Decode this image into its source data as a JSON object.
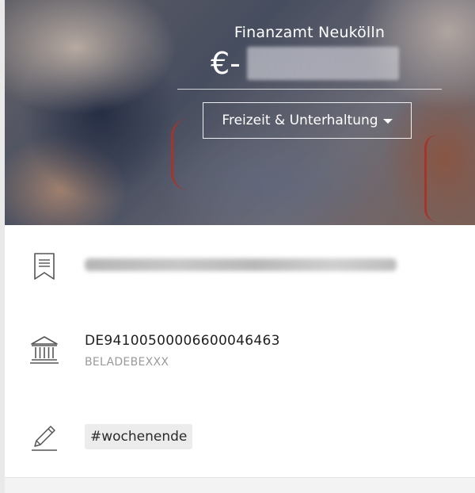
{
  "transaction": {
    "merchant": "Finanzamt Neukölln",
    "amount_prefix": "€-",
    "category_label": "Freizeit & Unterhaltung"
  },
  "details": {
    "iban": "DE94100500006600046463",
    "bic": "BELADEBEXXX"
  },
  "tags": [
    "#wochenende"
  ],
  "icons": {
    "reference": "bookmark-icon",
    "bank": "bank-icon",
    "edit": "pencil-icon",
    "dropdown": "chevron-down-icon"
  },
  "colors": {
    "hero_text": "#ffffff",
    "iban_text": "#1e1e1e",
    "bic_text": "#9a9a9a",
    "tag_bg": "#ececec",
    "icon_stroke": "#555555"
  }
}
